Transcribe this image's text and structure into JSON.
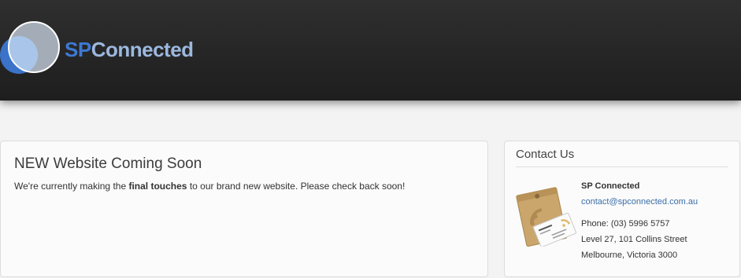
{
  "header": {
    "logo_sp": "SP",
    "logo_connected": "Connected"
  },
  "main": {
    "title": "NEW Website Coming Soon",
    "message_before": "We're currently making the ",
    "message_bold": "final touches",
    "message_after": " to our brand new website.  Please check back soon!"
  },
  "contact": {
    "title": "Contact Us",
    "company": "SP Connected",
    "email": "contact@spconnected.com.au",
    "phone": "Phone: (03) 5996 5757",
    "address_line1": "Level 27, 101 Collins Street",
    "address_line2": "Melbourne, Victoria 3000",
    "illustration_icon": "envelope-business-card-icon"
  },
  "colors": {
    "header_bg": "#222222",
    "logo_sp": "#3e79d2",
    "logo_connected": "#9cb8de",
    "link": "#3a6ea8"
  }
}
